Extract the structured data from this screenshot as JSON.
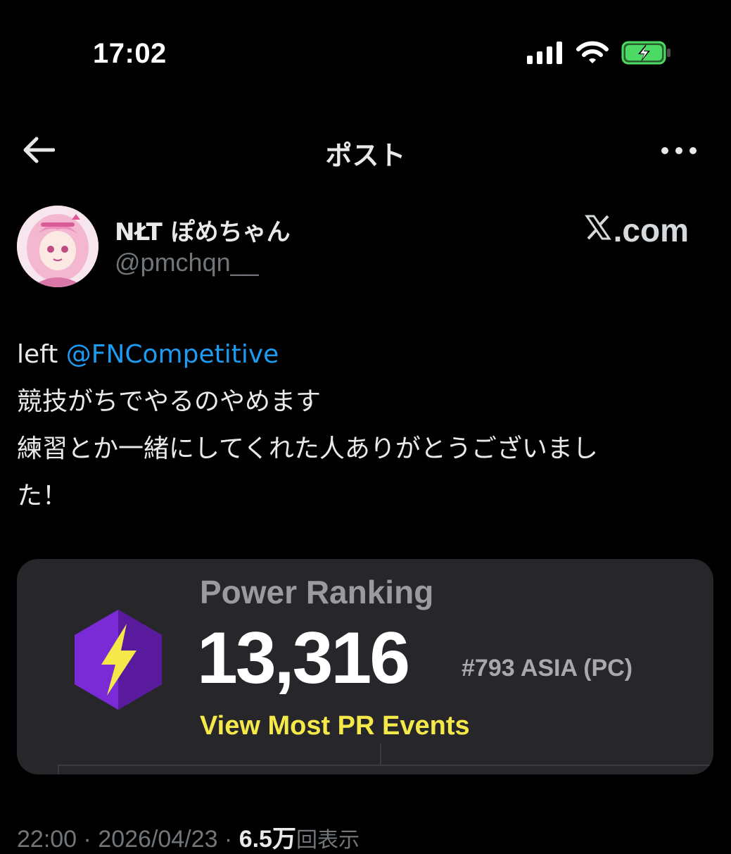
{
  "status_bar": {
    "time": "17:02",
    "icons": [
      "signal-icon",
      "wifi-icon",
      "battery-charging-icon"
    ],
    "battery_color": "#4cd964"
  },
  "header": {
    "title": "ポスト",
    "back_icon": "arrow-left-icon",
    "more_icon": "more-horizontal-icon"
  },
  "author": {
    "name": "NŁT ぽめちゃん",
    "handle": "@pmchqn__",
    "watermark": "X.com"
  },
  "post": {
    "line1_prefix": "left ",
    "mention": "@FNCompetitive",
    "line2": "競技がちでやるのやめます",
    "line3": "練習とか一緒にしてくれた人ありがとうございまし",
    "line4": "た！",
    "mention_color": "#1d9bf0"
  },
  "card": {
    "title": "Power Ranking",
    "value": "13,316",
    "rank": "#793 ASIA (PC)",
    "link": "View Most PR Events",
    "badge_icon": "lightning-hexagon-icon",
    "accent_color": "#f5e94a",
    "badge_color": "#6a1fc0"
  },
  "meta": {
    "time": "22:00",
    "separator": " · ",
    "date": "2026/04/23",
    "views_count": "6.5万",
    "views_label": "回表示"
  }
}
